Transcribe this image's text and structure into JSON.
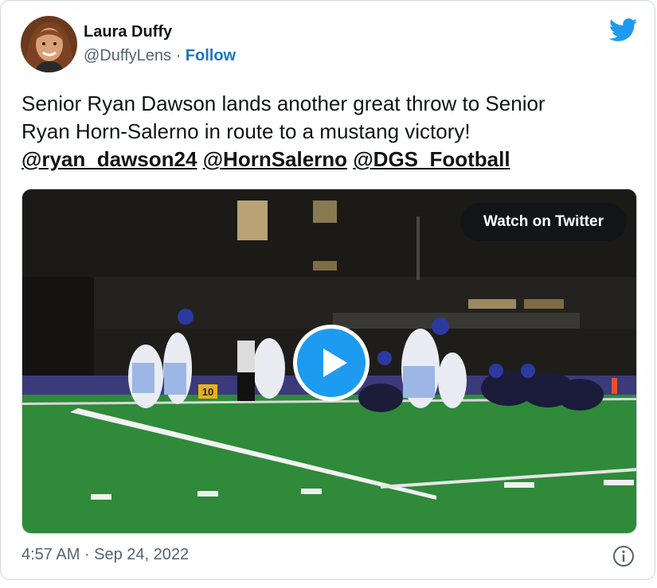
{
  "author": {
    "name": "Laura Duffy",
    "handle": "@DuffyLens",
    "separator": "·",
    "follow_label": "Follow"
  },
  "tweet": {
    "text_line1": "Senior Ryan Dawson lands another great throw to Senior",
    "text_line2": "Ryan Horn-Salerno in route to a mustang victory!",
    "mentions": [
      "@ryan_dawson24",
      "@HornSalerno",
      "@DGS_Football"
    ]
  },
  "media": {
    "watch_label": "Watch on Twitter",
    "yard_marker": "10"
  },
  "footer": {
    "timestamp": "4:57 AM · Sep 24, 2022"
  },
  "icons": {
    "brand": "twitter-bird-icon",
    "play": "play-icon",
    "info": "info-icon"
  },
  "colors": {
    "twitter_blue": "#1d9bf0",
    "follow_link": "#1d74c7",
    "secondary_text": "#536471",
    "field_green": "#2f8a3a"
  }
}
